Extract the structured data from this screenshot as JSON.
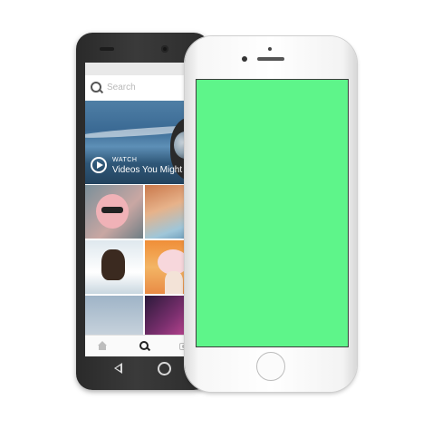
{
  "android_app": {
    "search_placeholder": "Search",
    "featured": {
      "label": "WATCH",
      "title": "Videos You Might Like"
    },
    "nav": {
      "home_icon": "home-icon",
      "search_icon": "search-icon",
      "camera_icon": "camera-icon"
    }
  },
  "iphone": {
    "screen_color": "#5ef58a"
  }
}
